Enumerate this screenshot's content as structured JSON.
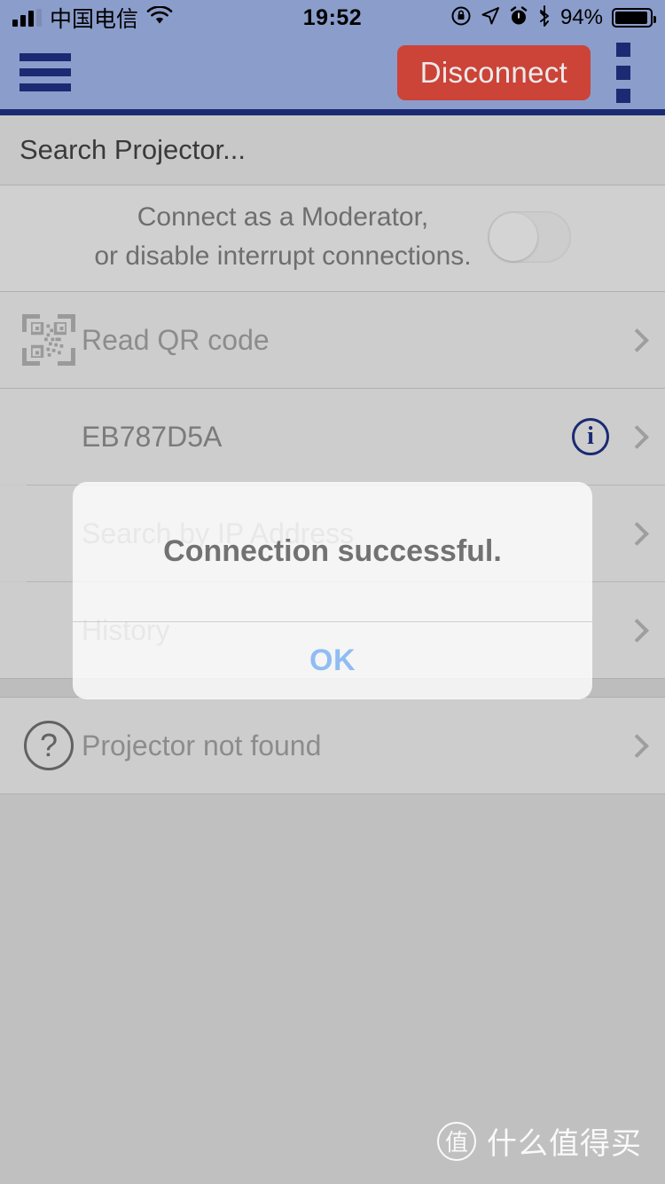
{
  "status_bar": {
    "carrier": "中国电信",
    "time": "19:52",
    "battery_percent": "94%",
    "icons": [
      "signal-bars-icon",
      "wifi-icon",
      "rotation-lock-icon",
      "location-arrow-icon",
      "alarm-clock-icon",
      "bluetooth-icon",
      "battery-icon"
    ]
  },
  "app_bar": {
    "menu_icon": "hamburger-menu-icon",
    "disconnect_label": "Disconnect",
    "overflow_icon": "kebab-menu-icon",
    "background_color": "#8b9dcb",
    "accent_color": "#1b2a72",
    "disconnect_color": "#cc4338"
  },
  "page": {
    "title": "Search Projector...",
    "moderator": {
      "line1": "Connect as a Moderator,",
      "line2": "or disable interrupt connections.",
      "toggle_state": "off"
    },
    "rows": [
      {
        "label": "Read QR code",
        "lead_icon": "qr-code-icon",
        "trail_icon": "chevron-right-icon"
      },
      {
        "label": "EB787D5A",
        "lead_icon": "",
        "trail_icon": "chevron-right-icon",
        "info_icon": "info-circle-icon"
      },
      {
        "label": "Search by IP Address",
        "lead_icon": "",
        "trail_icon": "chevron-right-icon"
      },
      {
        "label": "History",
        "lead_icon": "",
        "trail_icon": "chevron-right-icon"
      },
      {
        "label": "Projector not found",
        "lead_icon": "help-circle-icon",
        "trail_icon": "chevron-right-icon"
      }
    ]
  },
  "dialog": {
    "message": "Connection successful.",
    "ok_label": "OK",
    "ok_color": "#3c8cf0"
  },
  "watermark": {
    "badge": "值",
    "text": "什么值得买"
  }
}
